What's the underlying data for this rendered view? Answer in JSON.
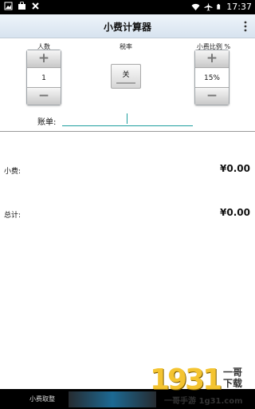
{
  "status_bar": {
    "time": "17:37",
    "icons": [
      "gallery-icon",
      "shopping-bag-icon",
      "close-x-icon",
      "wifi-icon",
      "airplane-icon",
      "battery-icon"
    ]
  },
  "action_bar": {
    "title": "小费计算器",
    "overflow_icon": "overflow-menu-icon"
  },
  "people": {
    "label": "人数",
    "value": "1",
    "plus": "+",
    "minus": "−"
  },
  "tax": {
    "label": "税率",
    "toggle_label": "关"
  },
  "tip_percent": {
    "label": "小费比例 %",
    "value": "15%",
    "plus": "+",
    "minus": "−"
  },
  "bill": {
    "label": "账单:",
    "value": ""
  },
  "results": {
    "tip_label": "小费:",
    "tip_value": "¥0.00",
    "total_label": "总计:",
    "total_value": "¥0.00"
  },
  "nav_bar": {
    "app_label": "小费取整"
  },
  "watermark": {
    "number": "1931",
    "side_text_top": "一哥",
    "side_text_bottom": "下载",
    "url_text": "一哥手游 1g31.com"
  },
  "colors": {
    "accent": "#1d9e9e",
    "action_bar_top": "#eef4fa",
    "action_bar_bottom": "#d7e3ef"
  }
}
